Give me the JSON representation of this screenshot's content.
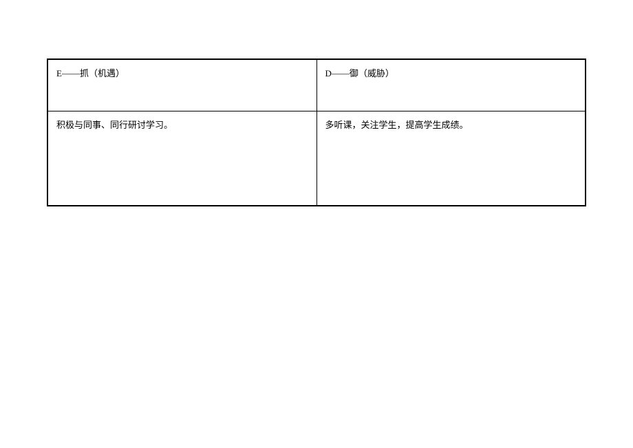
{
  "table": {
    "rows": [
      {
        "left": "E——抓（机遇）",
        "right": "D——御（威胁）"
      },
      {
        "left": "积极与同事、同行研讨学习。",
        "right": "多听课，关注学生，提高学生成绩。"
      }
    ]
  }
}
